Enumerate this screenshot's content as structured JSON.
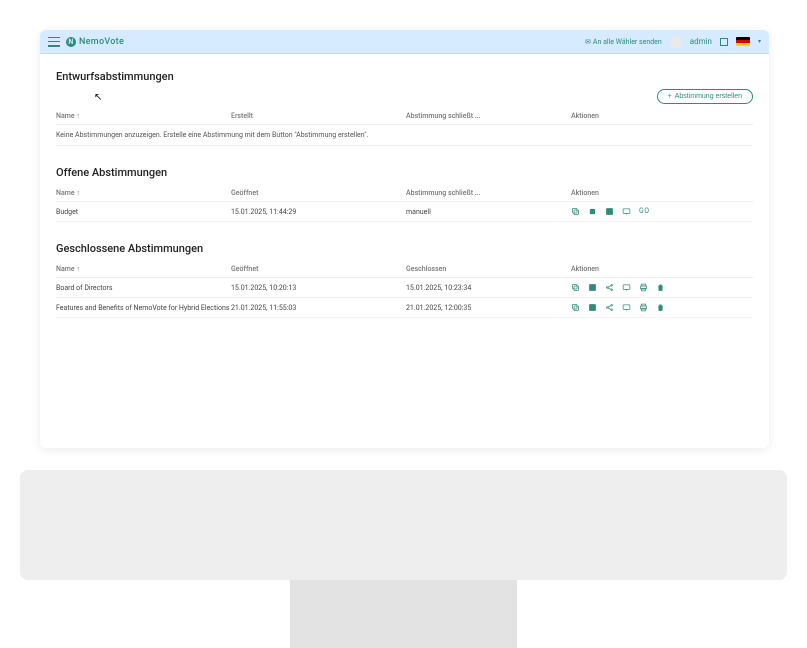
{
  "header": {
    "brand": "NemoVote",
    "send_label": "An alle Wähler senden",
    "username": "admin"
  },
  "create_button": "Abstimmung erstellen",
  "sections": {
    "draft": {
      "title": "Entwurfsabstimmungen",
      "columns": {
        "name": "Name",
        "created": "Erstellt",
        "closes": "Abstimmung schließt ...",
        "actions": "Aktionen"
      },
      "empty": "Keine Abstimmungen anzuzeigen. Erstelle eine Abstimmung mit dem Button \"Abstimmung erstellen\"."
    },
    "open": {
      "title": "Offene Abstimmungen",
      "columns": {
        "name": "Name",
        "opened": "Geöffnet",
        "closes": "Abstimmung schließt ...",
        "actions": "Aktionen"
      },
      "rows": [
        {
          "name": "Budget",
          "opened": "15.01.2025, 11:44:29",
          "closes": "manuell"
        }
      ]
    },
    "closed": {
      "title": "Geschlossene Abstimmungen",
      "columns": {
        "name": "Name",
        "opened": "Geöffnet",
        "closed": "Geschlossen",
        "actions": "Aktionen"
      },
      "rows": [
        {
          "name": "Board of Directors",
          "opened": "15.01.2025, 10:20:13",
          "closed": "15.01.2025, 10:23:34"
        },
        {
          "name": "Features and Benefits of NemoVote for Hybrid Elections",
          "opened": "21.01.2025, 11:55:03",
          "closed": "21.01.2025, 12:00:35"
        }
      ]
    }
  },
  "go_label": "GO"
}
